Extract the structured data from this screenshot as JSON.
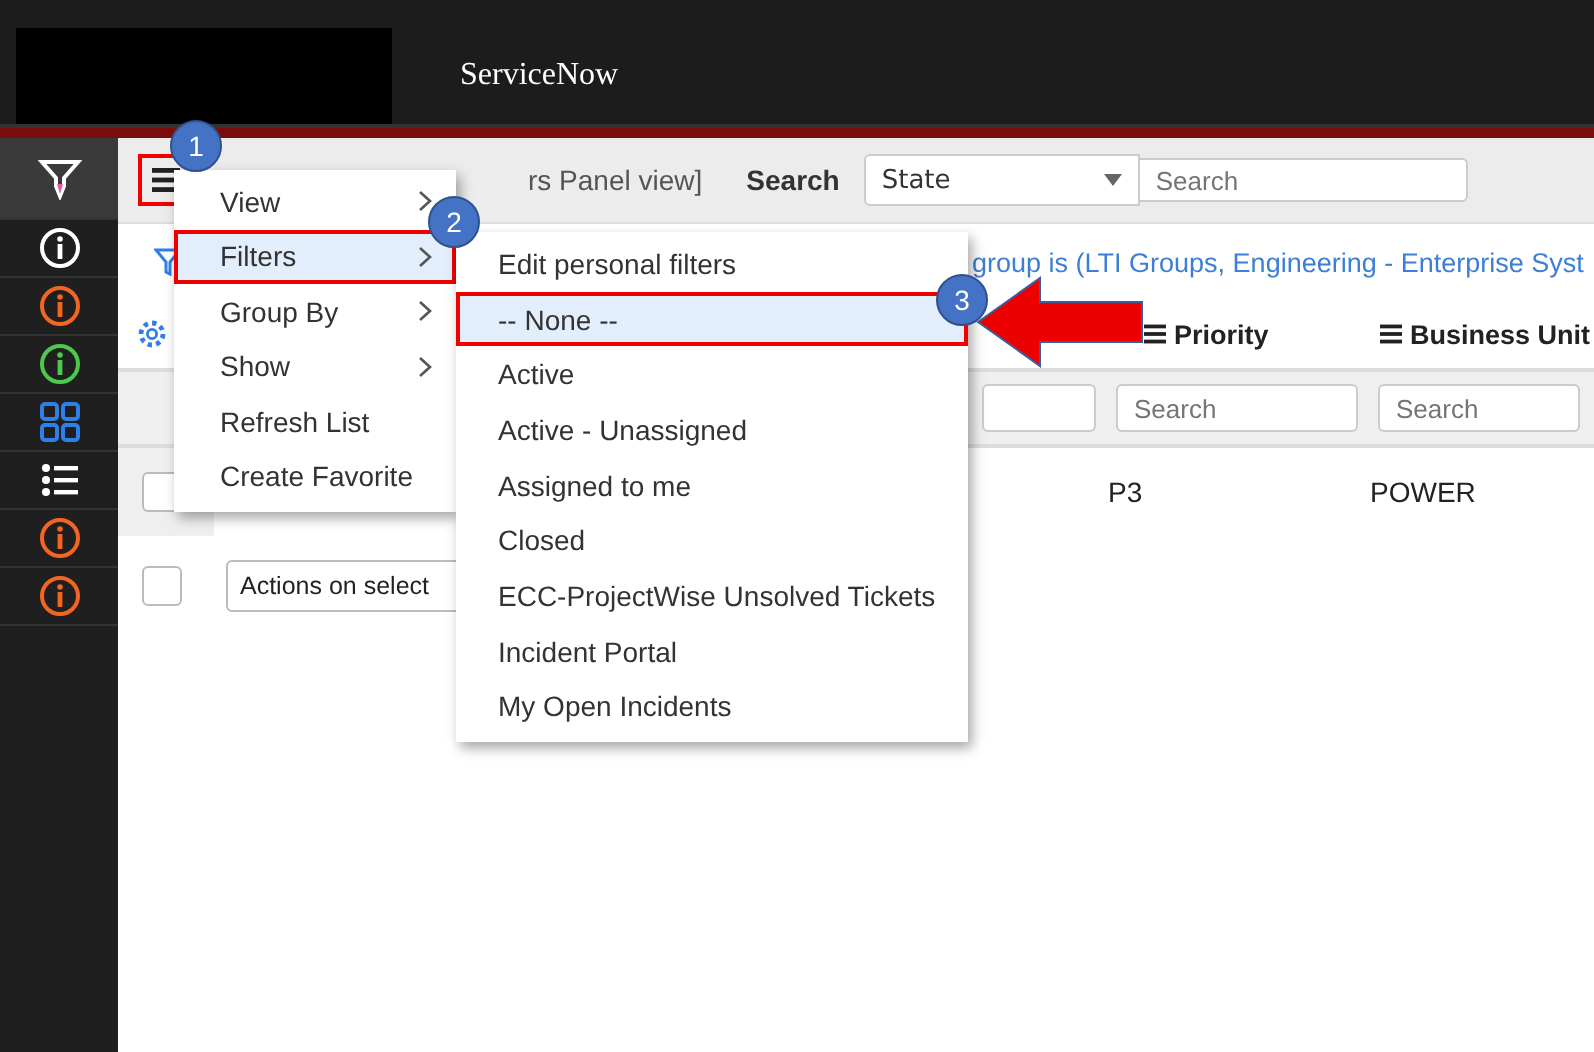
{
  "header": {
    "title": "ServiceNow"
  },
  "sidebar": {
    "items": [
      {
        "kind": "filter",
        "selected": true,
        "color": "#ffffff"
      },
      {
        "kind": "info",
        "selected": false,
        "color": "#ffffff"
      },
      {
        "kind": "info",
        "selected": false,
        "color": "#f26522"
      },
      {
        "kind": "info",
        "selected": false,
        "color": "#4cc94c"
      },
      {
        "kind": "grid",
        "selected": false,
        "color": "#2f7fe8"
      },
      {
        "kind": "list",
        "selected": false,
        "color": "#ffffff"
      },
      {
        "kind": "info",
        "selected": false,
        "color": "#f26522"
      },
      {
        "kind": "info",
        "selected": false,
        "color": "#f26522"
      }
    ]
  },
  "toolbar": {
    "menu_highlighted": true,
    "title_fragment": "rs Panel view]",
    "search_label": "Search",
    "field_select": "State",
    "search_placeholder": "Search"
  },
  "breadcrumb": "group is (LTI Groups, Engineering - Enterprise Syst",
  "table": {
    "columns": [
      {
        "label": "Priority"
      },
      {
        "label": "Business Unit"
      }
    ],
    "column_search": [
      {
        "placeholder": "Search"
      },
      {
        "placeholder": "Search"
      }
    ],
    "rows": [
      {
        "checked": false,
        "cells": [
          "P3",
          "POWER"
        ]
      }
    ]
  },
  "actions": {
    "checked": false,
    "label": "Actions on select"
  },
  "context_menu": {
    "items": [
      {
        "label": "View",
        "submenu": true,
        "selected": false
      },
      {
        "label": "Filters",
        "submenu": true,
        "selected": true
      },
      {
        "label": "Group By",
        "submenu": true,
        "selected": false
      },
      {
        "label": "Show",
        "submenu": true,
        "selected": false
      },
      {
        "label": "Refresh List",
        "submenu": false,
        "selected": false
      },
      {
        "label": "Create Favorite",
        "submenu": false,
        "selected": false
      }
    ]
  },
  "submenu": {
    "items": [
      {
        "label": "Edit personal filters",
        "selected": false
      },
      {
        "label": "-- None --",
        "selected": true
      },
      {
        "label": "Active",
        "selected": false
      },
      {
        "label": "Active - Unassigned",
        "selected": false
      },
      {
        "label": "Assigned to me",
        "selected": false
      },
      {
        "label": "Closed",
        "selected": false
      },
      {
        "label": "ECC-ProjectWise Unsolved Tickets",
        "selected": false
      },
      {
        "label": "Incident Portal",
        "selected": false
      },
      {
        "label": "My Open Incidents",
        "selected": false
      }
    ]
  },
  "annotations": [
    {
      "number": "1"
    },
    {
      "number": "2"
    },
    {
      "number": "3"
    }
  ]
}
